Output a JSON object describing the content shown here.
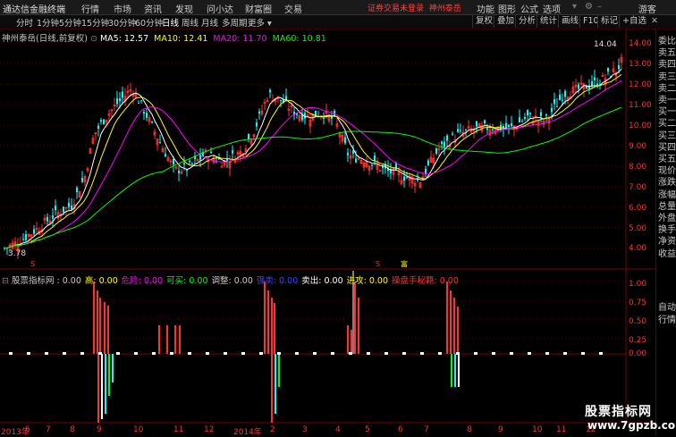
{
  "menubar": {
    "app_title": "通达信金融终端",
    "menus": [
      "行情",
      "市场",
      "资讯",
      "发现",
      "问小达",
      "财富圈",
      "交易"
    ],
    "alert": "证券交易未登录",
    "stock_tag": "神州泰岳",
    "right": [
      "功能",
      "图形",
      "公式",
      "选项"
    ],
    "guest": "游客"
  },
  "toolbar": {
    "periods": [
      "分时",
      "1分钟",
      "5分钟",
      "15分钟",
      "30分钟",
      "60分钟",
      "日线",
      "周线",
      "月线",
      "多周期",
      "更多"
    ],
    "active": "日线",
    "right": [
      "复权",
      "叠加",
      "分析",
      "统计",
      "画线",
      "F10",
      "标记",
      "+自选"
    ]
  },
  "price_legend": {
    "title": "神州泰岳(日线,前复权)",
    "ma5": "MA5: 12.57",
    "ma10": "MA10: 12.41",
    "ma20": "MA20: 11.70",
    "ma60": "MA60: 10.81",
    "c_ma5": "#ffffff",
    "c_ma10": "#ffff00",
    "c_ma20": "#ff00ff",
    "c_ma60": "#00ff00"
  },
  "price_axis": [
    "14.00",
    "13.00",
    "12.00",
    "11.00",
    "10.00",
    "9.00",
    "8.00",
    "7.00",
    "6.00",
    "5.00",
    "4.00"
  ],
  "high_label": "14.04",
  "low_label": "3.78",
  "markers": {
    "a": "S",
    "b": "S",
    "c": "富"
  },
  "indicator_legend": [
    {
      "text": "股票指标网 : 0.00",
      "color": "#c8c8c8"
    },
    {
      "text": "高: 0.00",
      "color": "#ffff00"
    },
    {
      "text": "危险: 0.00",
      "color": "#ff00ff"
    },
    {
      "text": "可买: 0.00",
      "color": "#00ff00"
    },
    {
      "text": "调整: 0.00",
      "color": "#c8c8c8"
    },
    {
      "text": "强卖: 0.00",
      "color": "#4040ff"
    },
    {
      "text": "卖出: 0.00",
      "color": "#ffffff"
    },
    {
      "text": "进攻: 0.00",
      "color": "#ffff00"
    },
    {
      "text": "操盘手秘籍: 0.00",
      "color": "#ff3030"
    }
  ],
  "indicator_axis": [
    "1.00",
    "0.75",
    "0.50",
    "0.25",
    "0.00"
  ],
  "x_axis": [
    "2013年",
    "6",
    "7",
    "8",
    "9",
    "10",
    "11",
    "12",
    "2014年",
    "2",
    "3",
    "4",
    "5",
    "6",
    "7",
    "8",
    "9",
    "10",
    "11",
    "12"
  ],
  "right_panel": [
    "委比",
    "卖五",
    "卖四",
    "卖三",
    "卖二",
    "卖一",
    "买一",
    "买二",
    "买三",
    "买四",
    "买五",
    "现价",
    "涨跌",
    "涨幅",
    "总量",
    "外盘",
    "换手",
    "净资",
    "收益"
  ],
  "right_panel_bottom": [
    "自动",
    "行情"
  ],
  "watermark": {
    "line1": "股票指标网",
    "line2": "www.7gpzb.com"
  }
}
